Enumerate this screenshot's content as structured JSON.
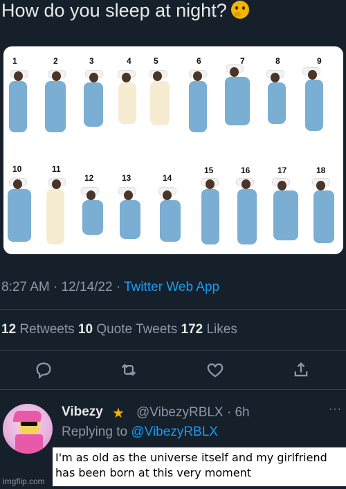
{
  "tweet": {
    "question": "How do you sleep at night?",
    "emoji": "thinking-face",
    "timestamp": "8:27 AM · 12/14/22 · ",
    "source": "Twitter Web App",
    "stats": {
      "retweets": "12",
      "retweets_label": " Retweets ",
      "quotes": "10",
      "quotes_label": " Quote Tweets ",
      "likes": "172",
      "likes_label": " Likes"
    }
  },
  "figure": {
    "numbers": [
      "1",
      "2",
      "3",
      "4",
      "5",
      "6",
      "7",
      "8",
      "9",
      "10",
      "11",
      "12",
      "13",
      "14",
      "15",
      "16",
      "17",
      "18"
    ]
  },
  "reply": {
    "name": "Vibezy",
    "badge": "star",
    "handle": "@VibezyRBLX · 6h",
    "replying_label": "Replying to ",
    "replying_to": "@VibezyRBLX",
    "more": "···"
  },
  "caption": "I'm as old as the universe itself and my girlfriend has been born at this very moment",
  "watermark": "imgflip.com",
  "colors": {
    "background": "#15202b",
    "link": "#1d9bf0",
    "muted": "#8b98a5",
    "text": "#e7e9ea"
  }
}
